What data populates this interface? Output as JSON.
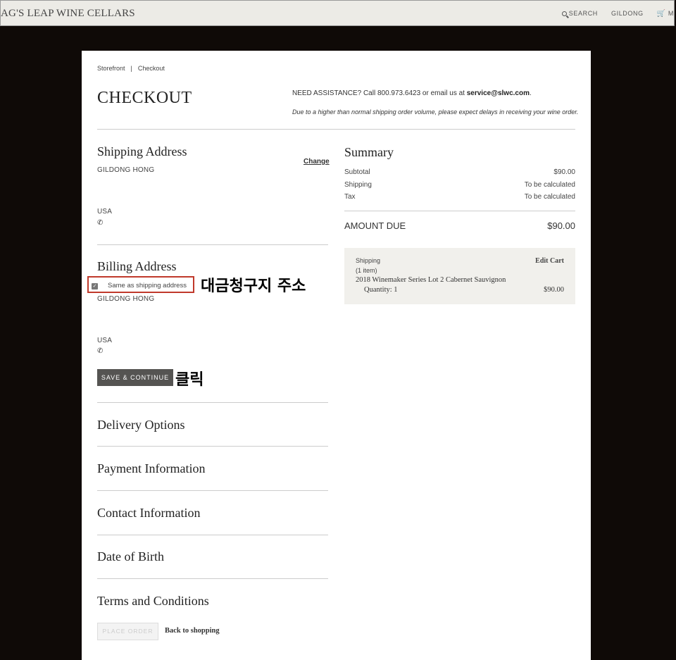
{
  "topbar": {
    "brand": "AG'S LEAP WINE CELLARS",
    "search_label": "SEARCH",
    "user_label": "GILDONG",
    "cart_label": "M"
  },
  "breadcrumb": {
    "home": "Storefront",
    "sep": "|",
    "current": "Checkout"
  },
  "page": {
    "title": "CHECKOUT",
    "assist_prefix": "NEED ASSISTANCE? Call 800.973.6423 or email us at ",
    "assist_email": "service@slwc.com",
    "assist_suffix": ".",
    "notice": "Due to a higher than normal shipping order volume, please expect delays in receiving your wine order."
  },
  "shipping": {
    "heading": "Shipping Address",
    "change_label": "Change",
    "name": "GILDONG HONG",
    "country": "USA",
    "phone_icon": "phone-icon"
  },
  "billing": {
    "heading": "Billing Address",
    "same_label": "Same as shipping address",
    "same_checked": true,
    "name": "GILDONG HONG",
    "country": "USA",
    "save_label": "SAVE & CONTINUE"
  },
  "sections": [
    "Delivery Options",
    "Payment Information",
    "Contact Information",
    "Date of Birth",
    "Terms and Conditions"
  ],
  "footer": {
    "place_order": "PLACE ORDER",
    "back": "Back to shopping"
  },
  "summary": {
    "heading": "Summary",
    "rows": [
      {
        "label": "Subtotal",
        "value": "$90.00"
      },
      {
        "label": "Shipping",
        "value": "To be calculated"
      },
      {
        "label": "Tax",
        "value": "To be calculated"
      }
    ],
    "amount_label": "AMOUNT DUE",
    "amount_value": "$90.00",
    "cart": {
      "shipping_label": "Shipping",
      "items_count": "(1 item)",
      "edit_label": "Edit Cart",
      "item_name": "2018 Winemaker Series Lot 2 Cabernet Sauvignon",
      "quantity": "Quantity: 1",
      "price": "$90.00"
    }
  },
  "annotations": {
    "billing_note": "대금청구지 주소",
    "click_note": "클릭"
  },
  "colors": {
    "highlight_border": "#c0392b",
    "button_bg": "#555452",
    "page_bg": "#0f0a07"
  }
}
